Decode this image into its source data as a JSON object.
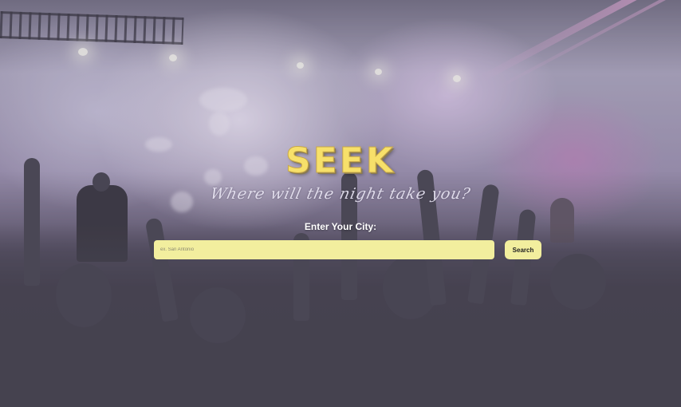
{
  "hero": {
    "title": "SEEK",
    "tagline": "Where will the night take you?"
  },
  "search": {
    "label": "Enter Your City:",
    "placeholder": "ex. San Antonio",
    "value": "",
    "button_label": "Search"
  },
  "theme": {
    "accent": "#f7e06a",
    "input_background": "#f2ee9e"
  }
}
